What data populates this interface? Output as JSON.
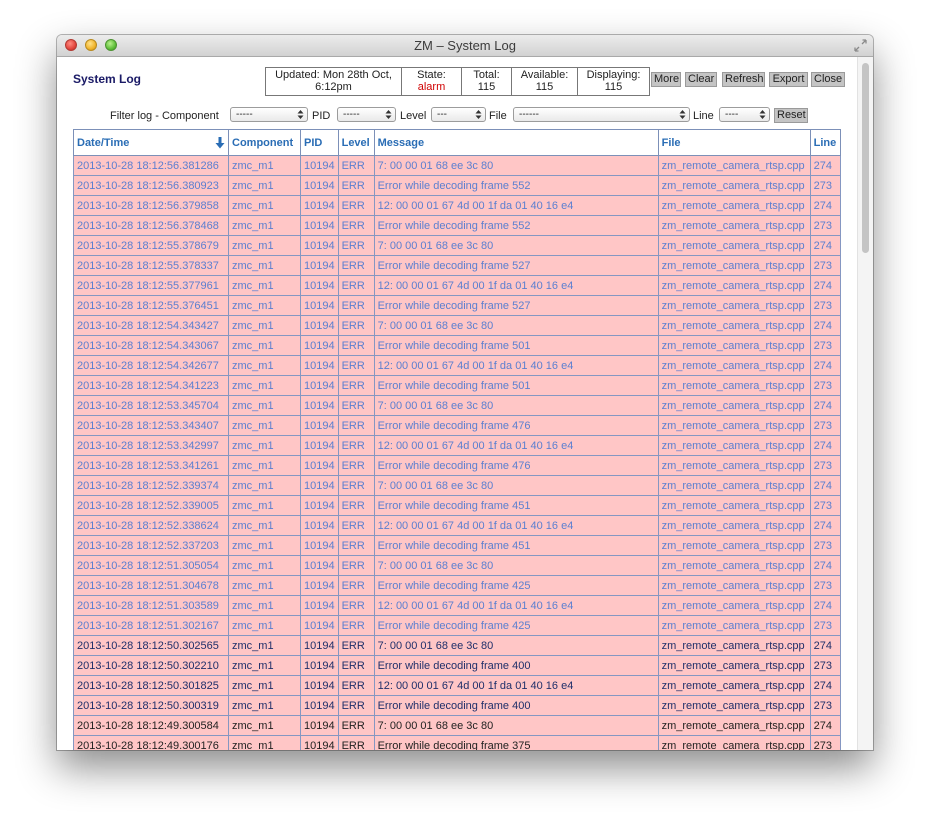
{
  "window": {
    "title": "ZM – System Log"
  },
  "page": {
    "title": "System Log"
  },
  "status": {
    "updated_label": "Updated:",
    "updated_value": "Mon 28th Oct, 6:12pm",
    "state_label": "State:",
    "state_value": "alarm",
    "total_label": "Total:",
    "total_value": "115",
    "available_label": "Available:",
    "available_value": "115",
    "displaying_label": "Displaying:",
    "displaying_value": "115"
  },
  "buttons": {
    "more": "More",
    "clear": "Clear",
    "refresh": "Refresh",
    "export": "Export",
    "close": "Close"
  },
  "filter": {
    "label": "Filter log - Component",
    "component_value": "-----",
    "pid_label": "PID",
    "pid_value": "-----",
    "level_label": "Level",
    "level_value": "---",
    "file_label": "File",
    "file_value": "------",
    "line_label": "Line",
    "line_value": "----",
    "reset_label": "Reset"
  },
  "table": {
    "headers": {
      "datetime": "Date/Time",
      "component": "Component",
      "pid": "PID",
      "level": "Level",
      "message": "Message",
      "file": "File",
      "line": "Line"
    },
    "rows": [
      {
        "datetime": "2013-10-28 18:12:56.381286",
        "component": "zmc_m1",
        "pid": "10194",
        "level": "ERR",
        "message": "7: 00 00 01 68 ee 3c 80",
        "file": "zm_remote_camera_rtsp.cpp",
        "line": "274"
      },
      {
        "datetime": "2013-10-28 18:12:56.380923",
        "component": "zmc_m1",
        "pid": "10194",
        "level": "ERR",
        "message": "Error while decoding frame 552",
        "file": "zm_remote_camera_rtsp.cpp",
        "line": "273"
      },
      {
        "datetime": "2013-10-28 18:12:56.379858",
        "component": "zmc_m1",
        "pid": "10194",
        "level": "ERR",
        "message": "12: 00 00 01 67 4d 00 1f da 01 40 16 e4",
        "file": "zm_remote_camera_rtsp.cpp",
        "line": "274"
      },
      {
        "datetime": "2013-10-28 18:12:56.378468",
        "component": "zmc_m1",
        "pid": "10194",
        "level": "ERR",
        "message": "Error while decoding frame 552",
        "file": "zm_remote_camera_rtsp.cpp",
        "line": "273"
      },
      {
        "datetime": "2013-10-28 18:12:55.378679",
        "component": "zmc_m1",
        "pid": "10194",
        "level": "ERR",
        "message": "7: 00 00 01 68 ee 3c 80",
        "file": "zm_remote_camera_rtsp.cpp",
        "line": "274"
      },
      {
        "datetime": "2013-10-28 18:12:55.378337",
        "component": "zmc_m1",
        "pid": "10194",
        "level": "ERR",
        "message": "Error while decoding frame 527",
        "file": "zm_remote_camera_rtsp.cpp",
        "line": "273"
      },
      {
        "datetime": "2013-10-28 18:12:55.377961",
        "component": "zmc_m1",
        "pid": "10194",
        "level": "ERR",
        "message": "12: 00 00 01 67 4d 00 1f da 01 40 16 e4",
        "file": "zm_remote_camera_rtsp.cpp",
        "line": "274"
      },
      {
        "datetime": "2013-10-28 18:12:55.376451",
        "component": "zmc_m1",
        "pid": "10194",
        "level": "ERR",
        "message": "Error while decoding frame 527",
        "file": "zm_remote_camera_rtsp.cpp",
        "line": "273"
      },
      {
        "datetime": "2013-10-28 18:12:54.343427",
        "component": "zmc_m1",
        "pid": "10194",
        "level": "ERR",
        "message": "7: 00 00 01 68 ee 3c 80",
        "file": "zm_remote_camera_rtsp.cpp",
        "line": "274"
      },
      {
        "datetime": "2013-10-28 18:12:54.343067",
        "component": "zmc_m1",
        "pid": "10194",
        "level": "ERR",
        "message": "Error while decoding frame 501",
        "file": "zm_remote_camera_rtsp.cpp",
        "line": "273"
      },
      {
        "datetime": "2013-10-28 18:12:54.342677",
        "component": "zmc_m1",
        "pid": "10194",
        "level": "ERR",
        "message": "12: 00 00 01 67 4d 00 1f da 01 40 16 e4",
        "file": "zm_remote_camera_rtsp.cpp",
        "line": "274"
      },
      {
        "datetime": "2013-10-28 18:12:54.341223",
        "component": "zmc_m1",
        "pid": "10194",
        "level": "ERR",
        "message": "Error while decoding frame 501",
        "file": "zm_remote_camera_rtsp.cpp",
        "line": "273"
      },
      {
        "datetime": "2013-10-28 18:12:53.345704",
        "component": "zmc_m1",
        "pid": "10194",
        "level": "ERR",
        "message": "7: 00 00 01 68 ee 3c 80",
        "file": "zm_remote_camera_rtsp.cpp",
        "line": "274"
      },
      {
        "datetime": "2013-10-28 18:12:53.343407",
        "component": "zmc_m1",
        "pid": "10194",
        "level": "ERR",
        "message": "Error while decoding frame 476",
        "file": "zm_remote_camera_rtsp.cpp",
        "line": "273"
      },
      {
        "datetime": "2013-10-28 18:12:53.342997",
        "component": "zmc_m1",
        "pid": "10194",
        "level": "ERR",
        "message": "12: 00 00 01 67 4d 00 1f da 01 40 16 e4",
        "file": "zm_remote_camera_rtsp.cpp",
        "line": "274"
      },
      {
        "datetime": "2013-10-28 18:12:53.341261",
        "component": "zmc_m1",
        "pid": "10194",
        "level": "ERR",
        "message": "Error while decoding frame 476",
        "file": "zm_remote_camera_rtsp.cpp",
        "line": "273"
      },
      {
        "datetime": "2013-10-28 18:12:52.339374",
        "component": "zmc_m1",
        "pid": "10194",
        "level": "ERR",
        "message": "7: 00 00 01 68 ee 3c 80",
        "file": "zm_remote_camera_rtsp.cpp",
        "line": "274"
      },
      {
        "datetime": "2013-10-28 18:12:52.339005",
        "component": "zmc_m1",
        "pid": "10194",
        "level": "ERR",
        "message": "Error while decoding frame 451",
        "file": "zm_remote_camera_rtsp.cpp",
        "line": "273"
      },
      {
        "datetime": "2013-10-28 18:12:52.338624",
        "component": "zmc_m1",
        "pid": "10194",
        "level": "ERR",
        "message": "12: 00 00 01 67 4d 00 1f da 01 40 16 e4",
        "file": "zm_remote_camera_rtsp.cpp",
        "line": "274"
      },
      {
        "datetime": "2013-10-28 18:12:52.337203",
        "component": "zmc_m1",
        "pid": "10194",
        "level": "ERR",
        "message": "Error while decoding frame 451",
        "file": "zm_remote_camera_rtsp.cpp",
        "line": "273"
      },
      {
        "datetime": "2013-10-28 18:12:51.305054",
        "component": "zmc_m1",
        "pid": "10194",
        "level": "ERR",
        "message": "7: 00 00 01 68 ee 3c 80",
        "file": "zm_remote_camera_rtsp.cpp",
        "line": "274"
      },
      {
        "datetime": "2013-10-28 18:12:51.304678",
        "component": "zmc_m1",
        "pid": "10194",
        "level": "ERR",
        "message": "Error while decoding frame 425",
        "file": "zm_remote_camera_rtsp.cpp",
        "line": "273"
      },
      {
        "datetime": "2013-10-28 18:12:51.303589",
        "component": "zmc_m1",
        "pid": "10194",
        "level": "ERR",
        "message": "12: 00 00 01 67 4d 00 1f da 01 40 16 e4",
        "file": "zm_remote_camera_rtsp.cpp",
        "line": "274"
      },
      {
        "datetime": "2013-10-28 18:12:51.302167",
        "component": "zmc_m1",
        "pid": "10194",
        "level": "ERR",
        "message": "Error while decoding frame 425",
        "file": "zm_remote_camera_rtsp.cpp",
        "line": "273"
      },
      {
        "datetime": "2013-10-28 18:12:50.302565",
        "component": "zmc_m1",
        "pid": "10194",
        "level": "ERR",
        "message": "7: 00 00 01 68 ee 3c 80",
        "file": "zm_remote_camera_rtsp.cpp",
        "line": "274"
      },
      {
        "datetime": "2013-10-28 18:12:50.302210",
        "component": "zmc_m1",
        "pid": "10194",
        "level": "ERR",
        "message": "Error while decoding frame 400",
        "file": "zm_remote_camera_rtsp.cpp",
        "line": "273"
      },
      {
        "datetime": "2013-10-28 18:12:50.301825",
        "component": "zmc_m1",
        "pid": "10194",
        "level": "ERR",
        "message": "12: 00 00 01 67 4d 00 1f da 01 40 16 e4",
        "file": "zm_remote_camera_rtsp.cpp",
        "line": "274"
      },
      {
        "datetime": "2013-10-28 18:12:50.300319",
        "component": "zmc_m1",
        "pid": "10194",
        "level": "ERR",
        "message": "Error while decoding frame 400",
        "file": "zm_remote_camera_rtsp.cpp",
        "line": "273"
      },
      {
        "datetime": "2013-10-28 18:12:49.300584",
        "component": "zmc_m1",
        "pid": "10194",
        "level": "ERR",
        "message": "7: 00 00 01 68 ee 3c 80",
        "file": "zm_remote_camera_rtsp.cpp",
        "line": "274"
      },
      {
        "datetime": "2013-10-28 18:12:49.300176",
        "component": "zmc_m1",
        "pid": "10194",
        "level": "ERR",
        "message": "Error while decoding frame 375",
        "file": "zm_remote_camera_rtsp.cpp",
        "line": "273"
      }
    ]
  },
  "colors": {
    "row_background": "#ffc6c6",
    "row_border": "#8597c2",
    "header_text": "#2a6db5",
    "err_text": "#5b7fd0",
    "alarm_text": "#d00000",
    "page_title": "#1a1a66"
  },
  "icons": {
    "close": "close-icon",
    "minimize": "minimize-icon",
    "zoom": "zoom-icon",
    "fullscreen": "fullscreen-icon",
    "sort": "sort-descending-icon",
    "select": "select-arrows-icon"
  }
}
